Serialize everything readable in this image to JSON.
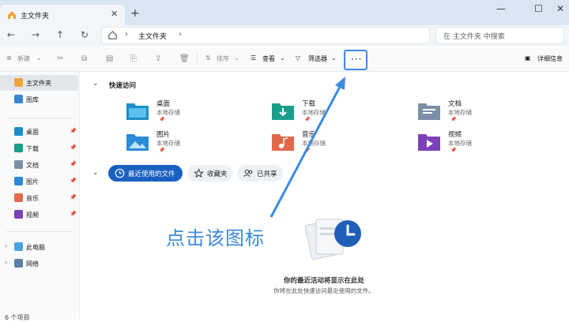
{
  "window": {
    "tab_title": "主文件夹",
    "new_tab": "+",
    "close_tab": "✕",
    "minimize": "—",
    "maximize": "☐",
    "close": "✕"
  },
  "address": {
    "path": "主文件夹",
    "search_placeholder": "在 主文件夹 中搜索"
  },
  "toolbar": {
    "new_label": "新建",
    "sort_label": "排序",
    "view_label": "查看",
    "filter_label": "筛选器",
    "more_label": "···",
    "details_label": "详细信息"
  },
  "sidebar": {
    "items": [
      {
        "label": "主文件夹",
        "icon": "home-icon"
      },
      {
        "label": "图库",
        "icon": "gallery-icon"
      },
      {
        "label": "桌面",
        "icon": "desktop-icon",
        "pinned": true
      },
      {
        "label": "下载",
        "icon": "download-icon",
        "pinned": true
      },
      {
        "label": "文档",
        "icon": "document-icon",
        "pinned": true
      },
      {
        "label": "图片",
        "icon": "pictures-icon",
        "pinned": true
      },
      {
        "label": "音乐",
        "icon": "music-icon",
        "pinned": true
      },
      {
        "label": "视频",
        "icon": "video-icon",
        "pinned": true
      },
      {
        "label": "此电脑",
        "icon": "pc-icon"
      },
      {
        "label": "网络",
        "icon": "network-icon"
      }
    ]
  },
  "quick_access": {
    "title": "快速访问",
    "folders": [
      {
        "name": "桌面",
        "sub": "本地存储",
        "color": "#1a8fc8"
      },
      {
        "name": "下载",
        "sub": "本地存储",
        "color": "#1a9e8c"
      },
      {
        "name": "文档",
        "sub": "本地存储",
        "color": "#7b8fa6"
      },
      {
        "name": "图片",
        "sub": "本地存储",
        "color": "#2c8ad6"
      },
      {
        "name": "音乐",
        "sub": "本地存储",
        "color": "#e0694a"
      },
      {
        "name": "视频",
        "sub": "本地存储",
        "color": "#7c3fb8"
      }
    ]
  },
  "recent": {
    "tabs": [
      "最近使用的文件",
      "收藏夹",
      "已共享"
    ],
    "empty_title": "你的最近活动将显示在此处",
    "empty_sub": "你将在此处快速访问最近使用的文件。"
  },
  "status": {
    "items": "6 个项目"
  },
  "annotation": {
    "text": "点击该图标",
    "color": "#3b8ae0"
  }
}
